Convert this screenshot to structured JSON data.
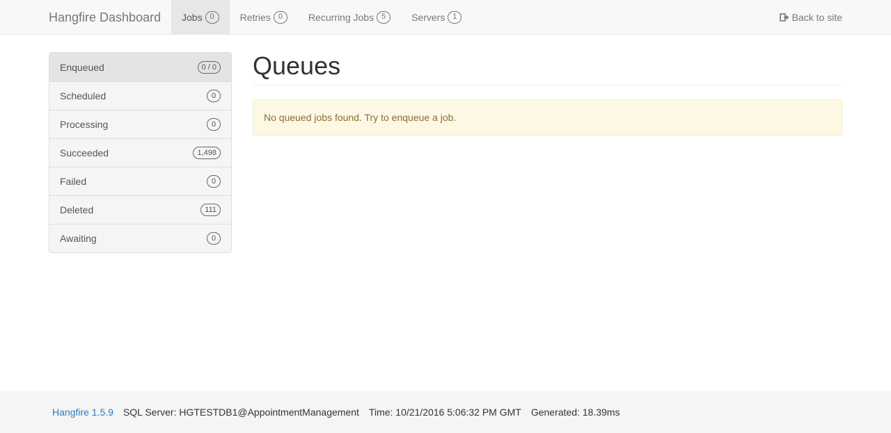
{
  "navbar": {
    "brand": "Hangfire Dashboard",
    "items": [
      {
        "label": "Jobs",
        "count": "0",
        "active": true
      },
      {
        "label": "Retries",
        "count": "0"
      },
      {
        "label": "Recurring Jobs",
        "count": "5"
      },
      {
        "label": "Servers",
        "count": "1"
      }
    ],
    "back_label": "Back to site",
    "back_icon": "sign-out-icon"
  },
  "sidebar": {
    "items": [
      {
        "label": "Enqueued",
        "count": "0 / 0",
        "active": true
      },
      {
        "label": "Scheduled",
        "count": "0"
      },
      {
        "label": "Processing",
        "count": "0"
      },
      {
        "label": "Succeeded",
        "count": "1,498"
      },
      {
        "label": "Failed",
        "count": "0"
      },
      {
        "label": "Deleted",
        "count": "111"
      },
      {
        "label": "Awaiting",
        "count": "0"
      }
    ]
  },
  "main": {
    "title": "Queues",
    "alert": "No queued jobs found. Try to enqueue a job."
  },
  "footer": {
    "version": "Hangfire 1.5.9",
    "storage": "SQL Server: HGTESTDB1@AppointmentManagement",
    "time": "Time: 10/21/2016 5:06:32 PM GMT",
    "generated": "Generated: 18.39ms"
  },
  "colors": {
    "navbar_bg": "#f8f8f8",
    "alert_bg": "#fcf8e3",
    "alert_text": "#8a6d3b",
    "link": "#337ab7"
  }
}
